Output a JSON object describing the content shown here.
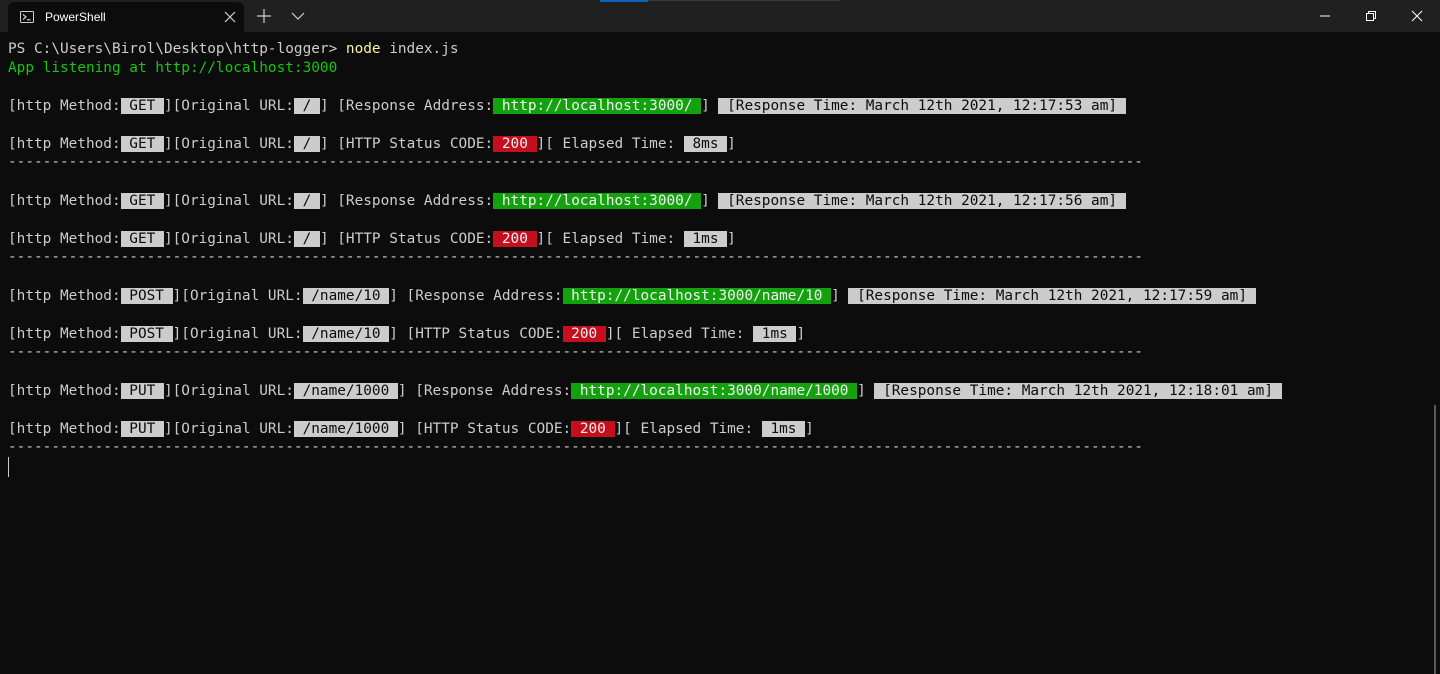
{
  "window": {
    "tab_title": "PowerShell",
    "tab_icon": "powershell-icon"
  },
  "terminal": {
    "prompt": "PS C:\\Users\\Birol\\Desktop\\http-logger> ",
    "command_name": "node",
    "command_args": " index.js",
    "listening": "App listening at http://localhost:3000",
    "labels": {
      "method": "[http Method:",
      "original_url": "][Original URL:",
      "response_address": "] [Response Address:",
      "response_time_open": " ",
      "status_code": "] [HTTP Status CODE:",
      "elapsed": "][ Elapsed Time: ",
      "close": "]",
      "close_space": "] "
    },
    "separator": "-----------------------------------------------------------------------------------------------------------------------------------",
    "entries": [
      {
        "method": " GET ",
        "url": " / ",
        "address": " http://localhost:3000/ ",
        "response_time": " [Response Time: March 12th 2021, 12:17:53 am] ",
        "status": " 200 ",
        "elapsed": " 8ms "
      },
      {
        "method": " GET ",
        "url": " / ",
        "address": " http://localhost:3000/ ",
        "response_time": " [Response Time: March 12th 2021, 12:17:56 am] ",
        "status": " 200 ",
        "elapsed": " 1ms "
      },
      {
        "method": " POST ",
        "url": " /name/10 ",
        "address": " http://localhost:3000/name/10 ",
        "response_time": " [Response Time: March 12th 2021, 12:17:59 am] ",
        "status": " 200 ",
        "elapsed": " 1ms "
      },
      {
        "method": " PUT ",
        "url": " /name/1000 ",
        "address": " http://localhost:3000/name/1000 ",
        "response_time": " [Response Time: March 12th 2021, 12:18:01 am] ",
        "status": " 200 ",
        "elapsed": " 1ms "
      }
    ]
  },
  "colors": {
    "background": "#0c0c0c",
    "titlebar": "#202020",
    "foreground": "#cccccc",
    "command": "#f9f1a5",
    "green_text": "#16c60c",
    "green_bg": "#13a10e",
    "red_bg": "#c50f1f"
  }
}
